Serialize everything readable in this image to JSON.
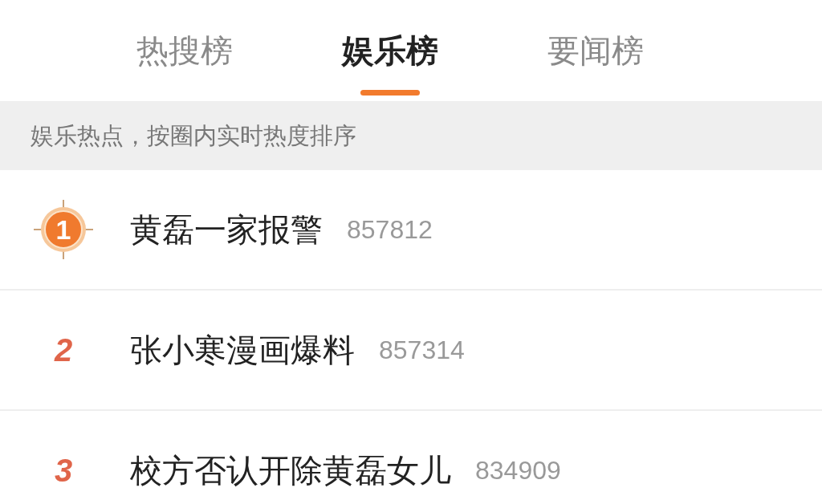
{
  "tabs": [
    {
      "label": "热搜榜",
      "selected": false
    },
    {
      "label": "娱乐榜",
      "selected": true
    },
    {
      "label": "要闻榜",
      "selected": false
    }
  ],
  "notice": "娱乐热点，按圈内实时热度排序",
  "items": [
    {
      "rank": "1",
      "kind": "badge",
      "title": "黄磊一家报警",
      "heat": "857812"
    },
    {
      "rank": "2",
      "kind": "number",
      "title": "张小寒漫画爆料",
      "heat": "857314"
    },
    {
      "rank": "3",
      "kind": "number",
      "title": "校方否认开除黄磊女儿",
      "heat": "834909"
    }
  ]
}
